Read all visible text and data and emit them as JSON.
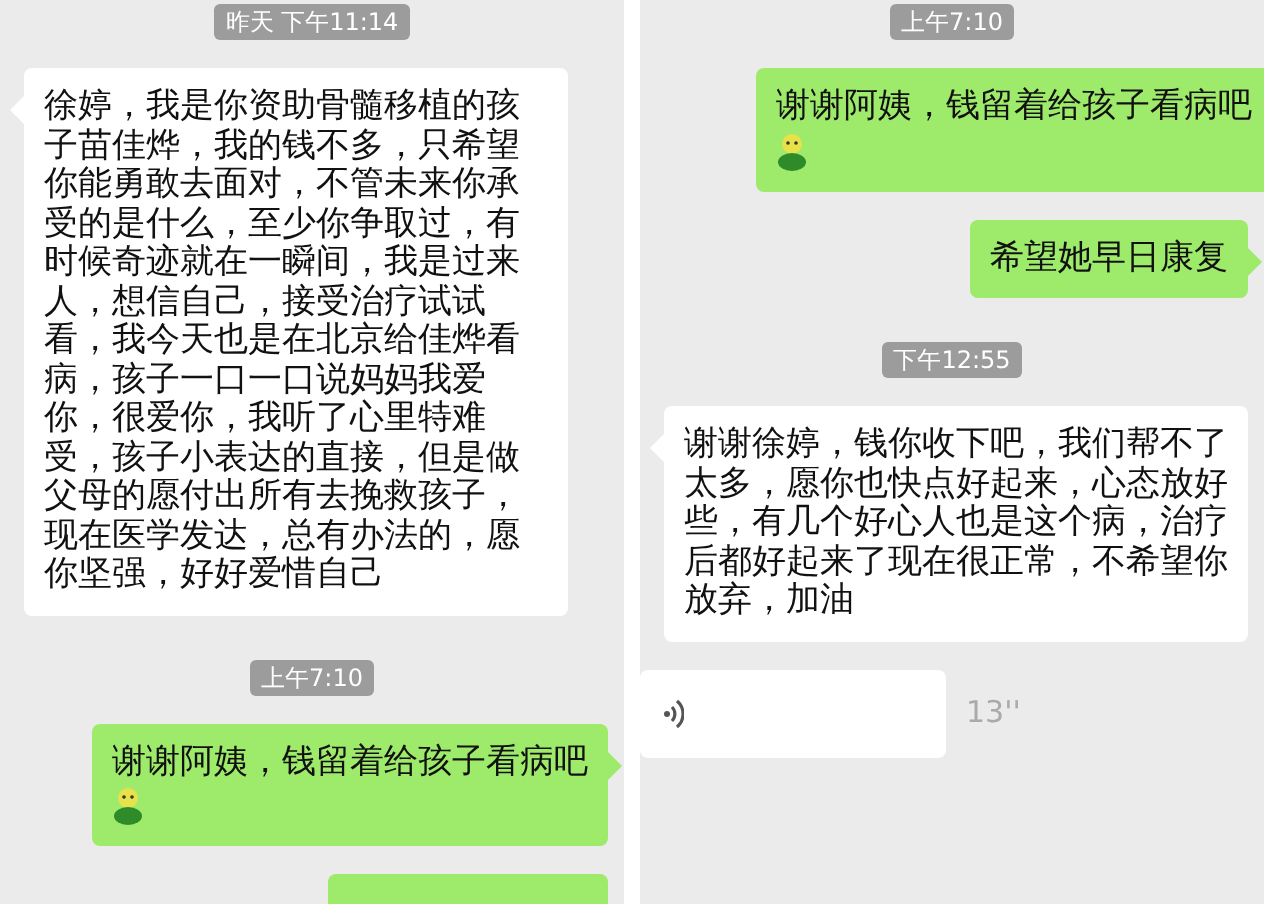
{
  "panels": [
    {
      "messages": [
        {
          "kind": "time",
          "text": "昨天 下午11:14"
        },
        {
          "kind": "text",
          "outgoing": false,
          "text": "徐婷，我是你资助骨髓移植的孩子苗佳烨，我的钱不多，只希望你能勇敢去面对，不管未来你承受的是什么，至少你争取过，有时候奇迹就在一瞬间，我是过来人，想信自己，接受治疗试试看，我今天也是在北京给佳烨看病，孩子一口一口说妈妈我爱你，很爱你，我听了心里特难受，孩子小表达的直接，但是做父母的愿付出所有去挽救孩子，现在医学发达，总有办法的，愿你坚强，好好爱惜自己",
          "emoji": false
        },
        {
          "kind": "time",
          "text": "上午7:10"
        },
        {
          "kind": "text",
          "outgoing": true,
          "text": "谢谢阿姨，钱留着给孩子看病吧",
          "emoji": true
        },
        {
          "kind": "cut",
          "outgoing": true
        }
      ]
    },
    {
      "messages": [
        {
          "kind": "time",
          "text": "上午7:10"
        },
        {
          "kind": "text",
          "outgoing": true,
          "text": "谢谢阿姨，钱留着给孩子看病吧",
          "emoji": true
        },
        {
          "kind": "text",
          "outgoing": true,
          "text": "希望她早日康复",
          "emoji": false
        },
        {
          "kind": "time",
          "text": "下午12:55"
        },
        {
          "kind": "text",
          "outgoing": false,
          "text": "谢谢徐婷，钱你收下吧，我们帮不了太多，愿你也快点好起来，心态放好些，有几个好心人也是这个病，治疗后都好起来了现在很正常，不希望你放弃，加油",
          "emoji": false
        },
        {
          "kind": "voice",
          "outgoing": false,
          "duration": "13''"
        }
      ]
    }
  ]
}
